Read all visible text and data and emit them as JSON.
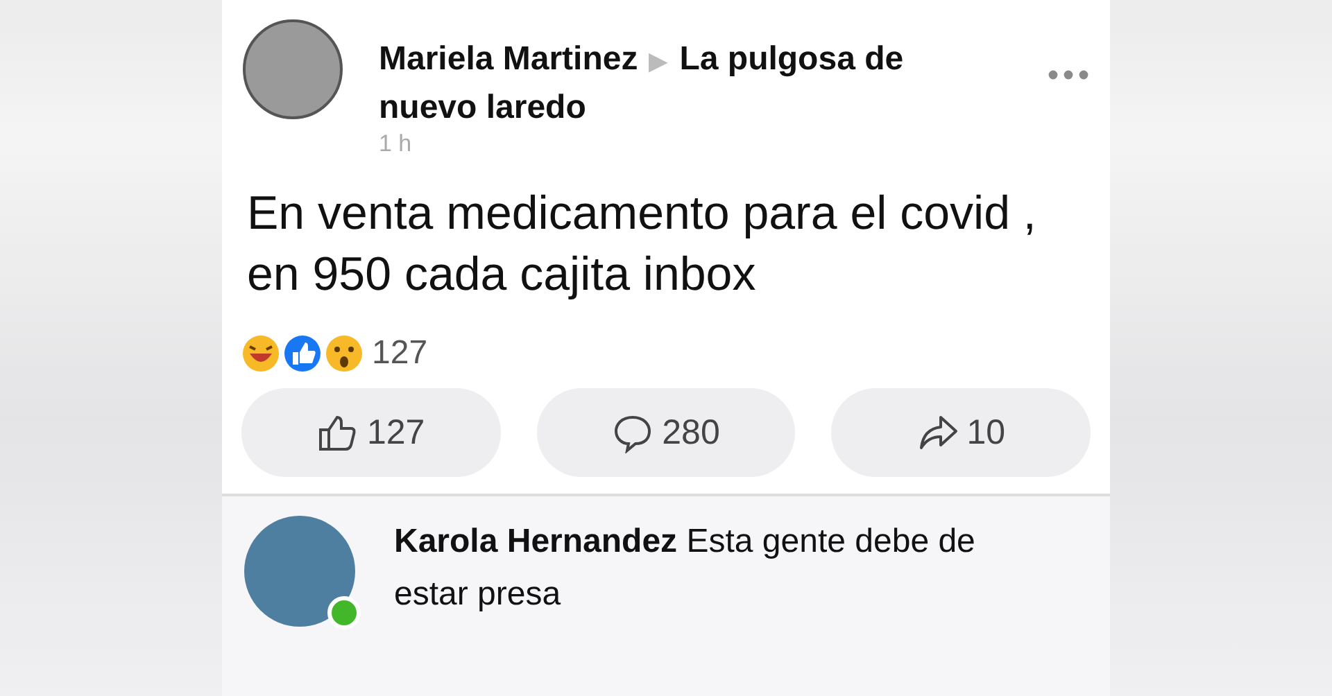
{
  "post": {
    "author": "Mariela Martinez",
    "separator": "▶",
    "group": "La pulgosa de nuevo laredo",
    "time": "1 h",
    "text": "En venta medicamento para el covid , en 950 cada cajita inbox"
  },
  "reactions": {
    "count": "127"
  },
  "actions": [
    {
      "kind": "like",
      "count": "127"
    },
    {
      "kind": "comment",
      "count": "280"
    },
    {
      "kind": "share",
      "count": "10"
    }
  ],
  "comment": {
    "text": "**Karola Hernandez** Esta gente debe de estar presa",
    "online": true
  }
}
